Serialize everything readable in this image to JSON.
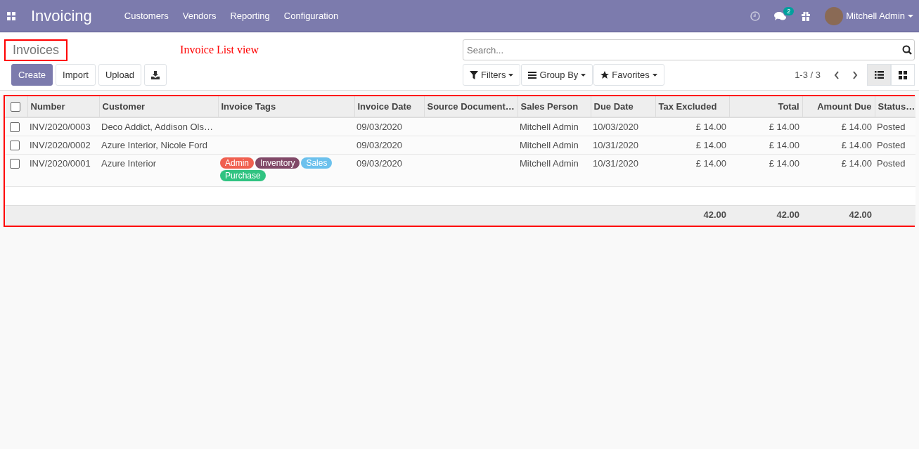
{
  "navbar": {
    "app_title": "Invoicing",
    "menu": [
      "Customers",
      "Vendors",
      "Reporting",
      "Configuration"
    ],
    "message_count": "2",
    "user": "Mitchell Admin"
  },
  "control_panel": {
    "title": "Invoices",
    "annotation": "Invoice List view",
    "buttons": [
      {
        "kind": "primary",
        "label": "Create"
      },
      {
        "kind": "secondary",
        "label": "Import"
      },
      {
        "kind": "secondary",
        "label": "Upload"
      },
      {
        "kind": "download"
      }
    ],
    "search": {
      "placeholder": "Search..."
    },
    "search_options": [
      {
        "kind": "filter",
        "label": "Filters"
      },
      {
        "kind": "group",
        "label": "Group By"
      },
      {
        "kind": "star",
        "label": "Favorites"
      }
    ],
    "pager": "1-3 / 3",
    "views": [
      {
        "kind": "list",
        "selected": true
      },
      {
        "kind": "kanban",
        "selected": false
      }
    ]
  },
  "table": {
    "select_all": {
      "checked": false
    },
    "columns": [
      "Number",
      "Customer",
      "Invoice Tags",
      "Invoice Date",
      "Source Document…",
      "Sales Person",
      "Due Date",
      "Tax Excluded",
      "Total",
      "Amount Due",
      "Status…"
    ],
    "rows": [
      {
        "checked": false,
        "number": "INV/2020/0003",
        "customer": "Deco Addict, Addison Ols…",
        "tags": [],
        "invoice_date": "09/03/2020",
        "source_document": "",
        "sales_person": "Mitchell Admin",
        "due_date": "10/03/2020",
        "tax_excluded": "£ 14.00",
        "total": "£ 14.00",
        "amount_due": "£ 14.00",
        "status": "Posted"
      },
      {
        "checked": false,
        "number": "INV/2020/0002",
        "customer": "Azure Interior, Nicole Ford",
        "tags": [],
        "invoice_date": "09/03/2020",
        "source_document": "",
        "sales_person": "Mitchell Admin",
        "due_date": "10/31/2020",
        "tax_excluded": "£ 14.00",
        "total": "£ 14.00",
        "amount_due": "£ 14.00",
        "status": "Posted"
      },
      {
        "checked": false,
        "number": "INV/2020/0001",
        "customer": "Azure Interior",
        "tags": [
          {
            "label": "Admin",
            "color": "#f06050"
          },
          {
            "label": "Inventory",
            "color": "#814968"
          },
          {
            "label": "Sales",
            "color": "#6cc1ed"
          },
          {
            "label": "Purchase",
            "color": "#30c381"
          }
        ],
        "invoice_date": "09/03/2020",
        "source_document": "",
        "sales_person": "Mitchell Admin",
        "due_date": "10/31/2020",
        "tax_excluded": "£ 14.00",
        "total": "£ 14.00",
        "amount_due": "£ 14.00",
        "status": "Posted"
      }
    ],
    "totals": {
      "tax_excluded": "42.00",
      "total": "42.00",
      "amount_due": "42.00"
    }
  }
}
